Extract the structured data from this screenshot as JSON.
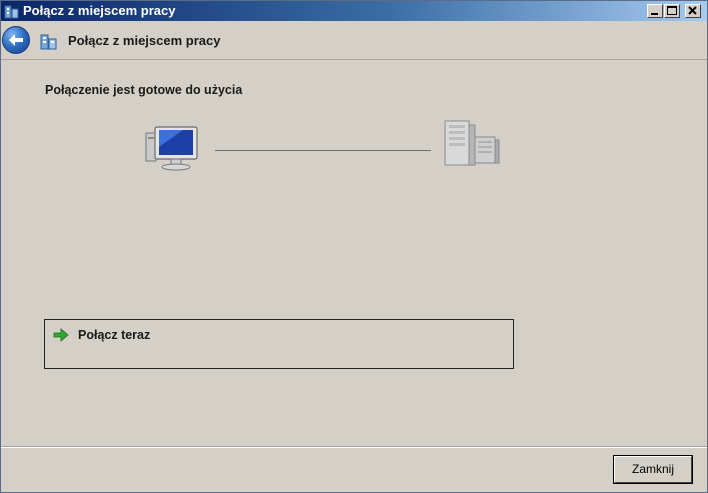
{
  "window": {
    "title": "Połącz z miejscem pracy",
    "titlebar_colors": [
      "#0a246a",
      "#a6caf0"
    ]
  },
  "header": {
    "back_icon": "back-arrow-icon",
    "icon": "workplace-network-icon",
    "title": "Połącz z miejscem pracy"
  },
  "main": {
    "status": "Połączenie jest gotowe do użycia",
    "left_icon": "computer-icon",
    "right_icon": "server-icon",
    "connect_option": {
      "icon": "green-arrow-icon",
      "label": "Połącz teraz"
    }
  },
  "footer": {
    "close_label": "Zamknij"
  }
}
